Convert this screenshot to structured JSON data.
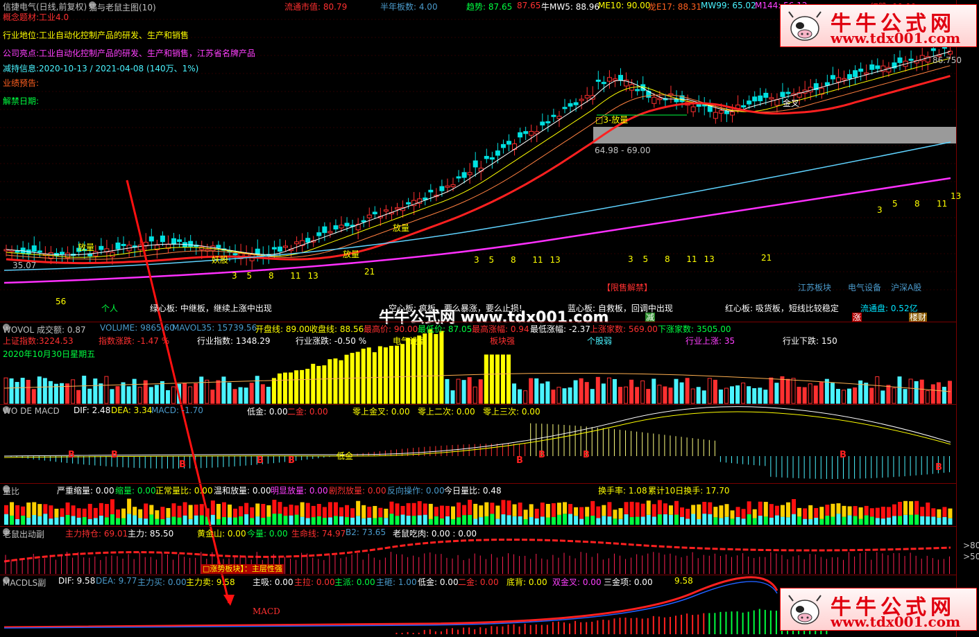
{
  "window": {
    "stock_name": "信捷电气(日线,前复权)",
    "indicator_name": "猫与老鼠主图(10)",
    "market_cap_label": "流通市值: 80.79",
    "half_year_label": "半年板数: 4.00",
    "trend_label": "趋势: 87.65",
    "trend_val2": "87.65",
    "mw5": "牛MW5: 88.96",
    "me10": "ME10: 90.00",
    "dragon": "龙E17: 88.31",
    "mw99": "MW99: 65.02",
    "m144": "M144: 56.12",
    "price_top": "红股: 90.00",
    "price_axis": "86.750"
  },
  "info": {
    "concept_label": "概念题材:",
    "concept_value": "工业4.0",
    "industry_label": "行业地位:",
    "industry_value": "工业自动化控制产品的研发、生产和销售",
    "highlight_label": "公司亮点:",
    "highlight_value": "工业自动化控制产品的研发、生产和销售，江苏省名牌产品",
    "reduce_label": "减持信息:",
    "reduce_value": "2020-10-13 / 2021-04-08 (140万、1%)",
    "forecast_label": "业绩预告:",
    "unlock_label": "解禁日期:"
  },
  "chart_labels": {
    "volume_release": "放量",
    "yao_gu": "妖股",
    "low_price": "35.07",
    "zone_label": "64.98 - 69.00",
    "jin_cha": "金叉",
    "b3_release": "□3-放量",
    "count_56": "56",
    "geren": "个人",
    "left_fib": [
      "3",
      "5",
      "8",
      "11",
      "13"
    ],
    "mid_fib": [
      "3",
      "5",
      "8",
      "11",
      "13"
    ],
    "right_fib": [
      "3",
      "5",
      "8",
      "11",
      "13"
    ],
    "far_fib": [
      "3",
      "5",
      "8",
      "11",
      "13"
    ],
    "n21a": "21",
    "n21b": "21",
    "xianshou": "【限售解禁】",
    "jiangsu": "江苏板块",
    "dianqi": "电气设备",
    "hushen": "沪深A股",
    "green_board": "绿心板: 中继板，继续上涨中出现",
    "empty_board": "空心板: 疯板，要么暴涨，要么止损!",
    "blue_board": "蓝心板: 自救板，回调中出现",
    "red_board": "红心板: 吸货板，短线比较稳定",
    "float_cap": "流通盘: 0.52亿",
    "jian": "减",
    "zhang": "涨",
    "louchai": "楼财"
  },
  "vol_panel": {
    "title": "WOVOL 成交额: 0.87",
    "volume": "VOLUME: 9865.60",
    "mavol": "MAVOL35: 15739.56",
    "open": "开盘线: 89.00",
    "close": "收盘线: 88.56",
    "high": "最高价: 90.00",
    "low": "最低价: 87.05",
    "high_pct": "最高涨幅: 0.94",
    "low_pct": "最低涨幅: -2.37",
    "up_count": "上涨家数: 569.00",
    "down_count": "下涨家数: 3505.00",
    "sh_index": "上证指数:3224.53",
    "idx_pct": "指数涨跌: -1.47 %",
    "ind_index": "行业指数: 1348.29",
    "ind_pct": "行业涨跌: -0.50 %",
    "ind_name": "电气设备",
    "board_strong": "板块强",
    "stock_weak": "个股弱",
    "ind_up": "行业上涨: 35",
    "ind_down": "行业下跌: 150",
    "date": "2020年10月30日星期五"
  },
  "macd_panel": {
    "title": "WO DE MACD",
    "dif": "DIF: 2.48",
    "dea": "DEA: 3.34",
    "macd": "MACD: -1.70",
    "low_gold": "低金: 0.00",
    "two_gold": "二金: 0.00",
    "zero_gold": "零上金叉: 0.00",
    "zero_two": "零上二次: 0.00",
    "zero_three": "零上三次: 0.00",
    "low_gold_mark": "低金"
  },
  "ratio_panel": {
    "title": "量比",
    "severe_shrink": "严重缩量: 0.00",
    "shrink": "缩量: 0.00",
    "normal": "正常量比: 0.00",
    "mild": "温和放量: 0.00",
    "obvious": "明显放量: 0.00",
    "sharp": "剧烈放量: 0.00",
    "reverse": "反向操作: 0.00",
    "today": "今日量比: 0.48",
    "turnover": "换手率: 1.08",
    "turnover10": "累计10日换手: 17.70"
  },
  "mouse_panel": {
    "title": "老鼠出动副",
    "main_hold": "主力持仓: 69.01",
    "main_force": "主力: 85.50",
    "gold_mtn": "黄金山: 0.00",
    "today_vol": "今量: 0.00",
    "life_line": "生命线: 74.97",
    "b2": "B2: 73.65",
    "mouse_eat": "老鼠吃肉: 0.00 : 0.00",
    "axis80": ">80",
    "axis50": ">50",
    "tag": "□涨势板块】：主层性强"
  },
  "macdls_panel": {
    "title": "MACDLS副",
    "dif": "DIF: 9.58",
    "dea": "DEA: 9.77",
    "buy": "主力买: 0.00",
    "sell": "主力卖: 9.58",
    "suck": "主吸: 0.00",
    "pull": "主拉: 0.00",
    "zhupai": "主派: 0.00",
    "zhuza": "主砸: 1.00",
    "low_gold": "低金: 0.00",
    "two_gold": "二金: 0.00",
    "bottom": "底背: 0.00",
    "dbl_gold": "双金叉: 0.00",
    "three_gold": "三金项: 0.00",
    "val": "9.58",
    "macd_anno": "MACD"
  },
  "watermark": {
    "cn": "牛牛公式网",
    "url": "www.tdx001.com",
    "center": "牛牛公式网 www.tdx001.com"
  },
  "colors": {
    "red": "#ff2020",
    "yellow": "#ffff00",
    "cyan": "#00e5ff",
    "magenta": "#ff40ff",
    "green": "#00ff40"
  }
}
